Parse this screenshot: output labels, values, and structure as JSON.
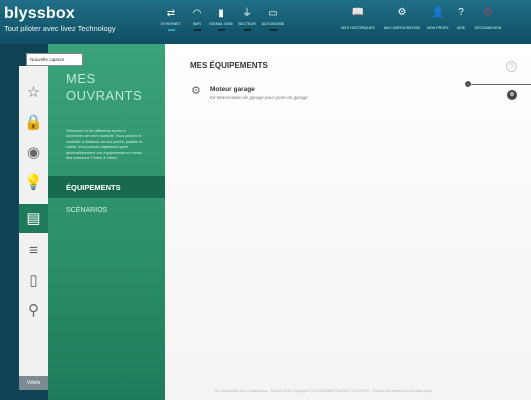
{
  "header": {
    "logo": "blyssbox",
    "tagline": "Tout piloter avec livez Technology",
    "status": [
      {
        "label": "ETHERNET",
        "icon": "ethernet-icon",
        "glyph": "⇄"
      },
      {
        "label": "WIFI",
        "icon": "wifi-icon",
        "glyph": "◠"
      },
      {
        "label": "SIGNAL GSM",
        "icon": "signal-icon",
        "glyph": "▮"
      },
      {
        "label": "SECTEUR",
        "icon": "plug-icon",
        "glyph": "⏚"
      },
      {
        "label": "AUTONOMIE",
        "icon": "battery-icon",
        "glyph": "▭"
      }
    ],
    "nav": [
      {
        "label": "MES HISTORIQUES",
        "icon": "book-icon",
        "glyph": "📖"
      },
      {
        "label": "MA CONFIGURATION",
        "icon": "config-icon",
        "glyph": "⚙"
      },
      {
        "label": "MON PROFIL",
        "icon": "profile-icon",
        "glyph": "👤"
      },
      {
        "label": "AIDE",
        "icon": "help-icon",
        "glyph": "?"
      },
      {
        "label": "DÉCONNEXION",
        "icon": "power-icon",
        "glyph": "⏻"
      }
    ]
  },
  "tooltip": "Nouvelle capture",
  "sidenav": {
    "title_line1": "MES",
    "title_line2": "OUVRANTS",
    "description": "Retrouvez ici les différents accès et ouvertures de votre domicile. Vous pouvez le contrôler à distance via vos portes, portails et volets. Vous pouvez également gérer automatiquement vos équipements en créant des scénarios 'Portes & Volets'.",
    "active_item": "ÉQUIPEMENTS",
    "item2": "SCÉNARIOS"
  },
  "iconbar": {
    "items": [
      {
        "icon": "star-icon",
        "glyph": "☆"
      },
      {
        "icon": "lock-icon",
        "glyph": "🔒"
      },
      {
        "icon": "camera-icon",
        "glyph": "◉"
      },
      {
        "icon": "bulb-icon",
        "glyph": "💡"
      },
      {
        "icon": "gate-icon",
        "glyph": "▤"
      },
      {
        "icon": "shutter-icon",
        "glyph": "≡"
      },
      {
        "icon": "bin-icon",
        "glyph": "▯"
      },
      {
        "icon": "tag-icon",
        "glyph": "⚲"
      }
    ],
    "bottom_label": "Volets"
  },
  "main": {
    "heading": "MES ÉQUIPEMENTS",
    "device_name": "Moteur garage",
    "device_desc": "Kit Motorisation de garage pour porte de garage",
    "footer": "En exclusivité chez Castorama - ©2016-2015 Copyright CASTORAMA FRANCE VOLEXCS - Tous droits réservés pour tous pays"
  }
}
